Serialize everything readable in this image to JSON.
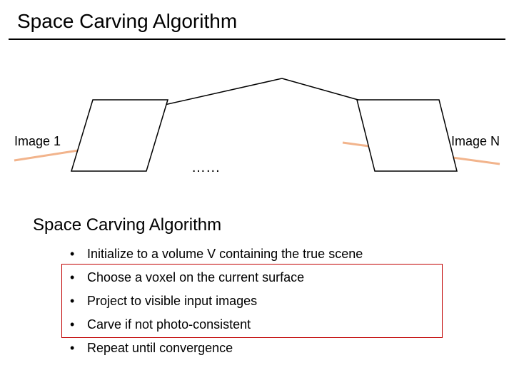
{
  "title": "Space Carving Algorithm",
  "diagram": {
    "label_left": "Image 1",
    "label_right": "Image N",
    "ellipsis": "…...",
    "colors": {
      "ray_left": "#f2b48c",
      "ray_right": "#f2b48c",
      "stroke": "#000000",
      "highlight_border": "#c00000"
    }
  },
  "subhead": "Space Carving Algorithm",
  "bullets": [
    "Initialize to a volume V containing the true scene",
    "Choose a voxel on the current surface",
    "Project to visible input images",
    "Carve if not photo-consistent",
    "Repeat until convergence"
  ]
}
